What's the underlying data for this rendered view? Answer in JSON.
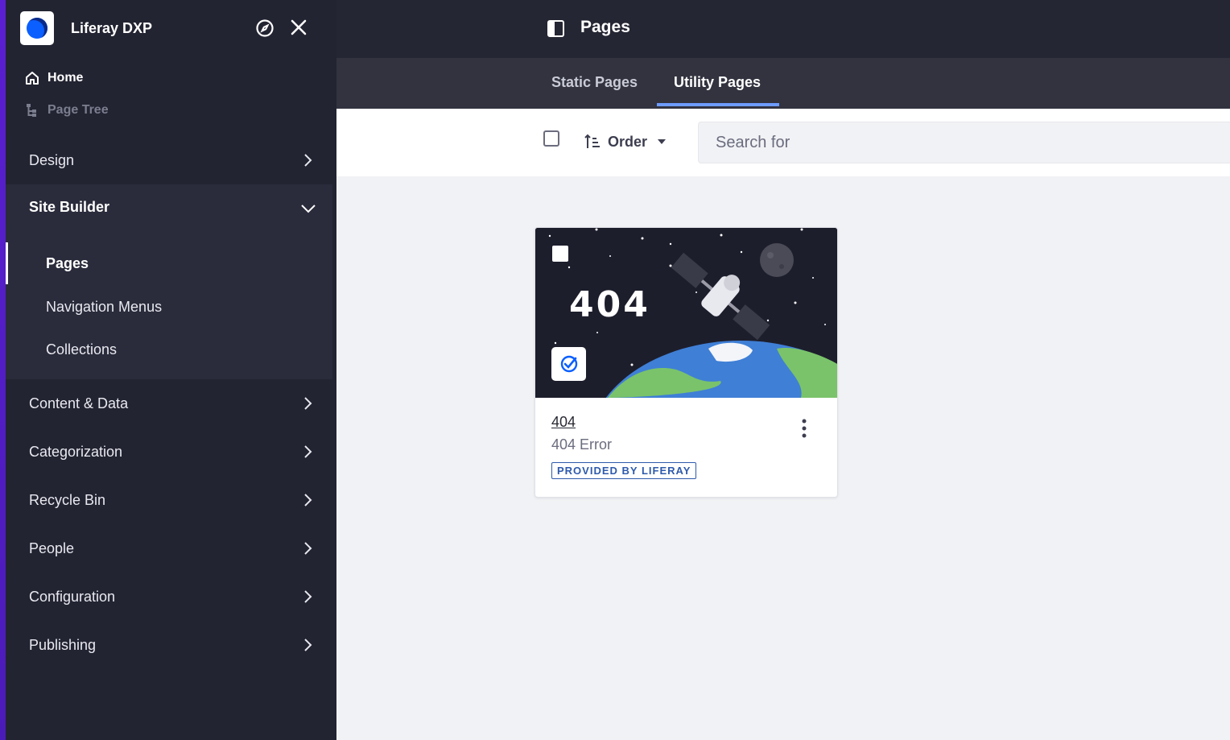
{
  "sidebar": {
    "brand": "Liferay DXP",
    "quick": [
      {
        "label": "Home",
        "icon": "home-icon"
      },
      {
        "label": "Page Tree",
        "icon": "page-tree-icon"
      }
    ],
    "design": "Design",
    "site_builder": {
      "label": "Site Builder",
      "items": [
        "Pages",
        "Navigation Menus",
        "Collections"
      ],
      "active": "Pages"
    },
    "items": [
      "Content & Data",
      "Categorization",
      "Recycle Bin",
      "People",
      "Configuration",
      "Publishing"
    ]
  },
  "header": {
    "title": "Pages"
  },
  "tabs": [
    {
      "label": "Static Pages",
      "active": false
    },
    {
      "label": "Utility Pages",
      "active": true
    }
  ],
  "toolbar": {
    "order_label": "Order",
    "search_placeholder": "Search for"
  },
  "card": {
    "image_text": "404",
    "title": "404",
    "subtitle": "404 Error",
    "label": "PROVIDED BY LIFERAY"
  },
  "colors": {
    "sidebar_bg": "#232432",
    "accent": "#0b5fff",
    "tab_underline": "#6d9cff",
    "edge": "#5a1fd1"
  }
}
